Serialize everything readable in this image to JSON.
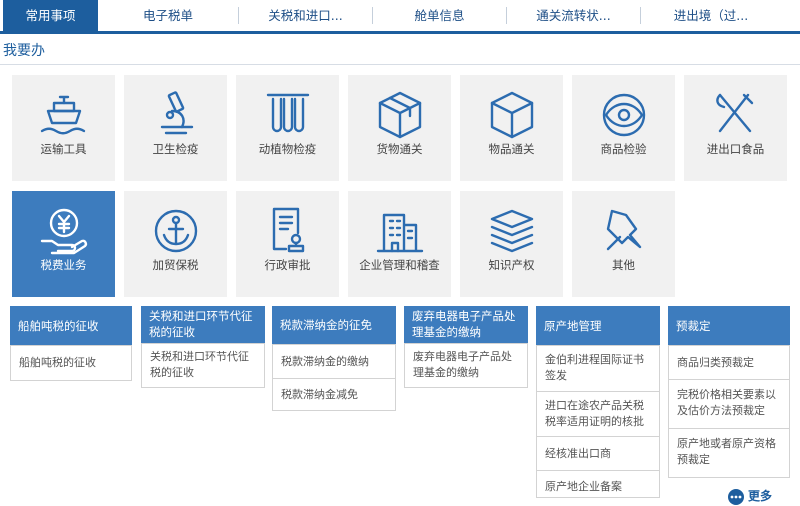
{
  "tabs": [
    "常用事项",
    "电子税单",
    "关税和进口...",
    "舱单信息",
    "通关流转状...",
    "进出境（过..."
  ],
  "section_title": "我要办",
  "tiles_row1": [
    "运输工具",
    "卫生检疫",
    "动植物检疫",
    "货物通关",
    "物品通关",
    "商品检验",
    "进出口食品"
  ],
  "tiles_row2": [
    "税费业务",
    "加贸保税",
    "行政审批",
    "企业管理和稽查",
    "知识产权",
    "其他"
  ],
  "cards": [
    {
      "title": "船舶吨税的征收",
      "items": [
        "船舶吨税的征收"
      ]
    },
    {
      "title": "关税和进口环节代征税的征收",
      "items": [
        "关税和进口环节代征税的征收"
      ]
    },
    {
      "title": "税款滞纳金的征免",
      "items": [
        "税款滞纳金的缴纳",
        "税款滞纳金减免"
      ]
    },
    {
      "title": "废弃电器电子产品处理基金的缴纳",
      "items": [
        "废弃电器电子产品处理基金的缴纳"
      ]
    },
    {
      "title": "原产地管理",
      "items": [
        "金伯利进程国际证书签发",
        "进口在途农产品关税税率适用证明的核批",
        "经核准出口商",
        "原产地企业备案"
      ]
    },
    {
      "title": "预裁定",
      "items": [
        "商品归类预裁定",
        "完税价格相关要素以及估价方法预裁定",
        "原产地或者原产资格预裁定"
      ]
    }
  ],
  "more_label": "更多",
  "colors": {
    "primary": "#1d5e9e",
    "accent": "#3d7cbe",
    "tile_bg": "#f1f1f1"
  }
}
